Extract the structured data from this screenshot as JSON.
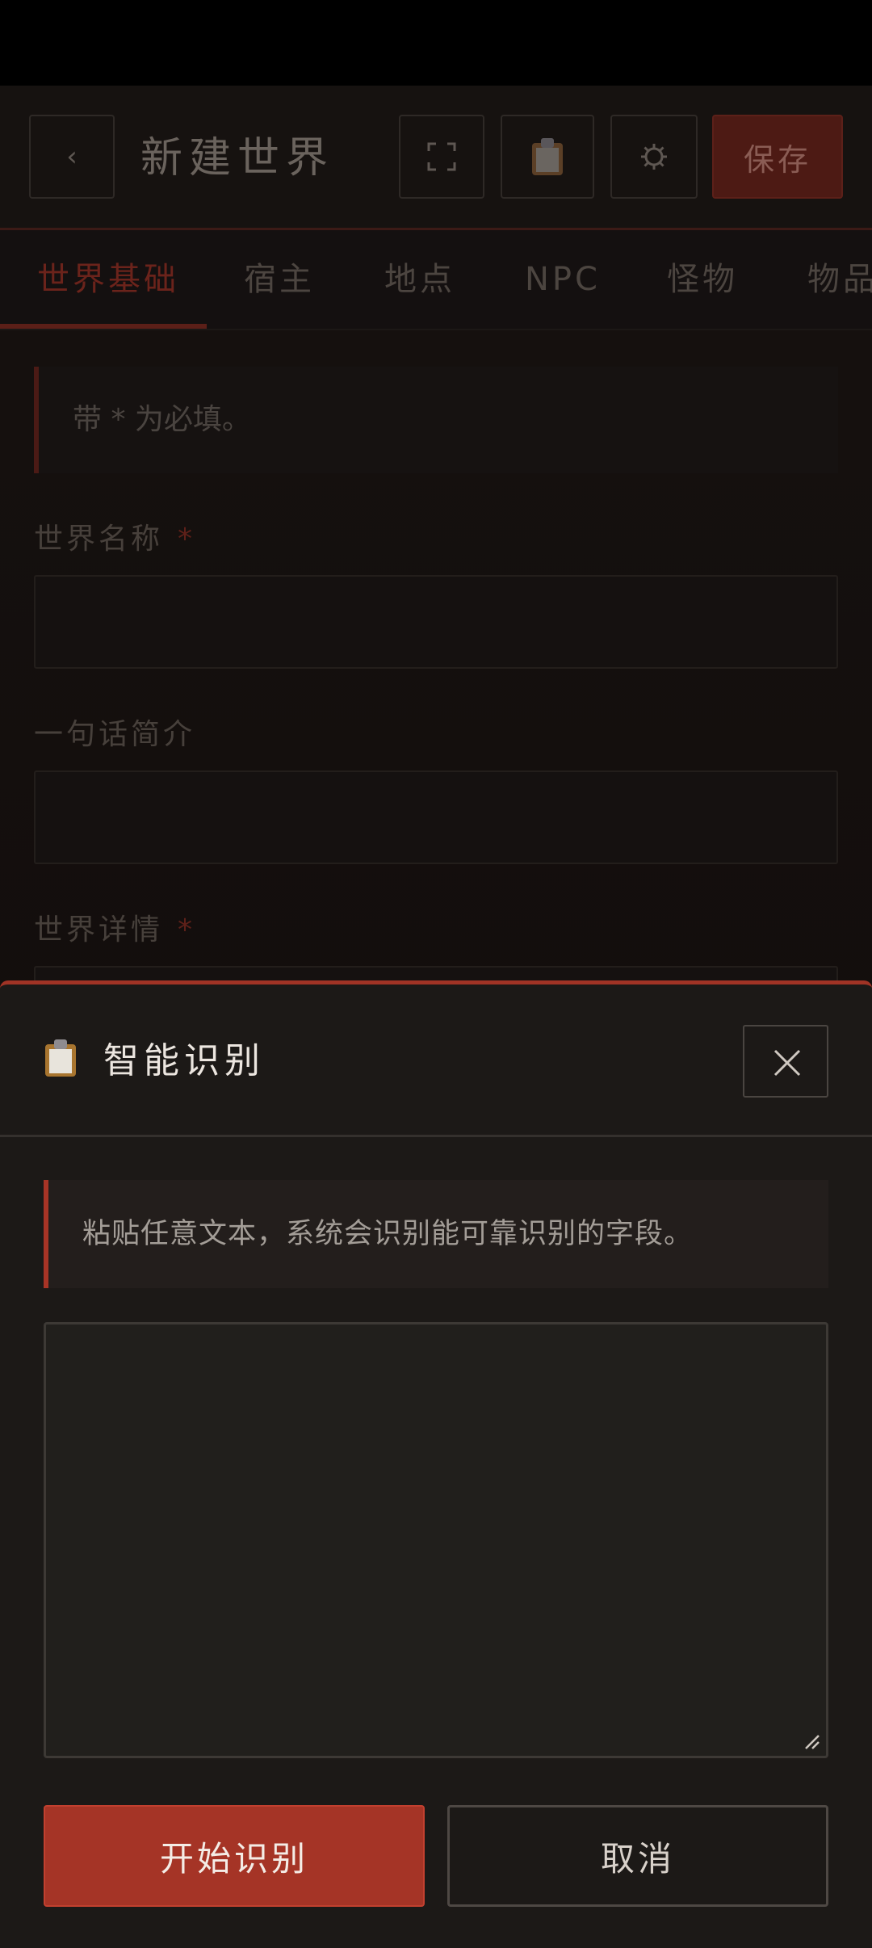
{
  "header": {
    "back_label": "‹",
    "title": "新建世界",
    "fullscreen_icon": "expand-icon",
    "clipboard_icon": "clipboard-icon",
    "gear_icon": "gear-icon",
    "save_label": "保存"
  },
  "tabs": [
    {
      "label": "世界基础",
      "active": true
    },
    {
      "label": "宿主",
      "active": false
    },
    {
      "label": "地点",
      "active": false
    },
    {
      "label": "NPC",
      "active": false
    },
    {
      "label": "怪物",
      "active": false
    },
    {
      "label": "物品",
      "active": false
    }
  ],
  "form": {
    "note": "带 * 为必填。",
    "world_name_label": "世界名称",
    "world_name_value": "",
    "tagline_label": "一句话简介",
    "tagline_value": "",
    "details_label": "世界详情",
    "required_mark": "*"
  },
  "modal": {
    "title": "智能识别",
    "hint": "粘贴任意文本，系统会识别能可靠识别的字段。",
    "textarea_value": "",
    "start_label": "开始识别",
    "cancel_label": "取消"
  },
  "colors": {
    "accent": "#a53426",
    "sheet_bg": "#1c1917",
    "page_bg": "#120d0c"
  }
}
